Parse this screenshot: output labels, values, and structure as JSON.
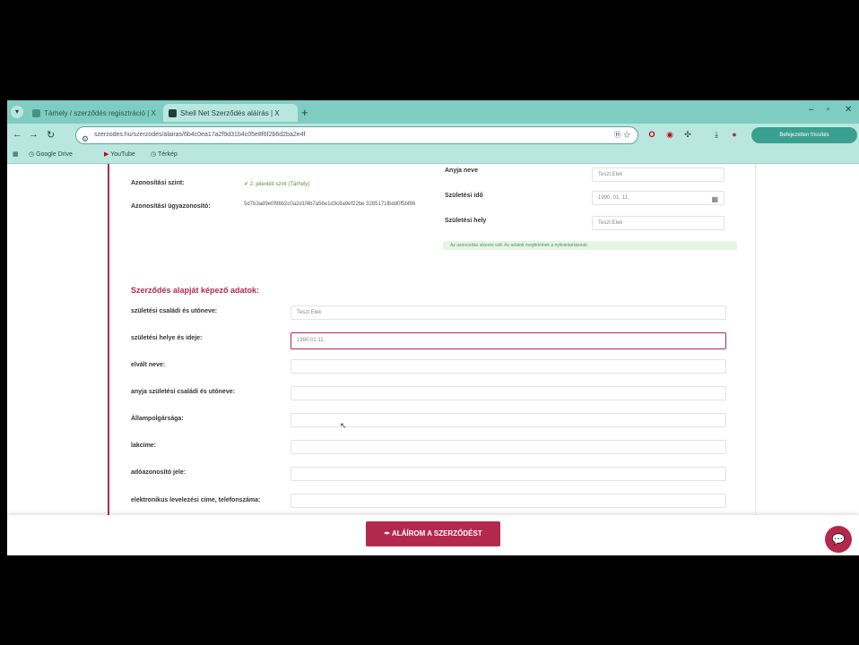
{
  "browser": {
    "tabs": [
      {
        "label": "Tárhely / szerződés regisztráció | X",
        "active": false
      },
      {
        "label": "Shell Net Szerződés aláírás | X",
        "active": true
      }
    ],
    "new_tab": "+",
    "url": "szerzodes.hu/szerzodes/alairas/6b4c0ea17a2f9d31b4c05e8f6f2b6d2ba2e4f",
    "url_actions": "Ⓗ ☆",
    "profile_label": "Befejezetlen frissítés",
    "bookmarks": [
      "Google Drive",
      "YouTube",
      "Térkép"
    ]
  },
  "left_fields": [
    {
      "label": "Azonosítási szint:",
      "value": "✔ 2. jelenléti szint (Tárhely)"
    },
    {
      "label": "Azonosítási ügyazonosító:",
      "value": "5d7b3ad9e0f96b2c0a2d1f4b7a56e1d3c8a9ef22be 3285171fbdd0f5bf86"
    }
  ],
  "right_fields": [
    {
      "label": "Anyja neve",
      "value": "Teszt Elek"
    },
    {
      "label": "Születési idő",
      "value": "1990. 01. 11."
    },
    {
      "label": "Születési hely",
      "value": "Teszt Elek"
    }
  ],
  "success_message": "Az azonosítás sikeres volt. Az adatok megfelelnek a nyilvántartásnak.",
  "section_title": "Szerződés alapját képező adatok:",
  "form_fields": [
    {
      "label": "születési családi és utóneve:",
      "value": "Teszt Elek"
    },
    {
      "label": "születési helye és ideje:",
      "value": "1990.01.11."
    },
    {
      "label": "elvált neve:",
      "value": ""
    },
    {
      "label": "anyja születési családi és utóneve:",
      "value": ""
    },
    {
      "label": "Állampolgársága:",
      "value": ""
    },
    {
      "label": "lakcíme:",
      "value": ""
    },
    {
      "label": "adóazonosító jele:",
      "value": ""
    },
    {
      "label": "elektronikus levelezési címe, telefonszáma:",
      "value": ""
    }
  ],
  "sign_button": "✒ ALÁÍROM A SZERZŐDÉST",
  "chat_icon": "chat-bubble"
}
